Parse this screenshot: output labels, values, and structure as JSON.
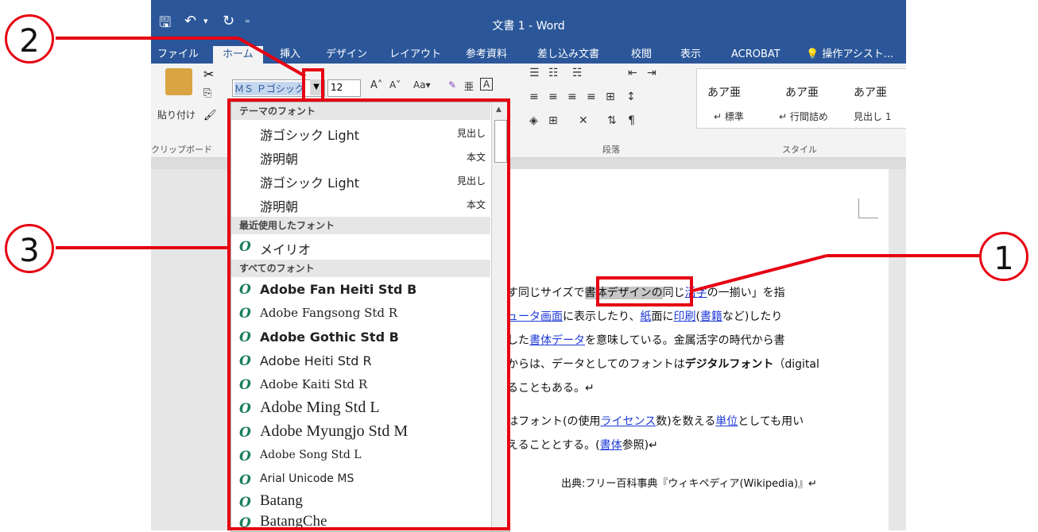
{
  "window": {
    "title": "文書 1 - Word",
    "quick_access": [
      "save-icon",
      "undo-icon",
      "redo-icon",
      "customize-icon"
    ]
  },
  "tabs": [
    {
      "label": "ファイル"
    },
    {
      "label": "ホーム",
      "active": true
    },
    {
      "label": "挿入"
    },
    {
      "label": "デザイン"
    },
    {
      "label": "レイアウト"
    },
    {
      "label": "参考資料"
    },
    {
      "label": "差し込み文書"
    },
    {
      "label": "校閲"
    },
    {
      "label": "表示"
    },
    {
      "label": "ACROBAT"
    }
  ],
  "tell_me": "操作アシスト...",
  "ribbon": {
    "paste_label": "貼り付け",
    "clipboard_label": "クリップボード",
    "font_name": "ＭＳ Ｐゴシック",
    "font_size": "12",
    "paragraph_label": "段落",
    "styles_label": "スタイル",
    "styles": [
      {
        "sample": "あア亜",
        "name": "↵ 標準"
      },
      {
        "sample": "あア亜",
        "name": "↵ 行間詰め"
      },
      {
        "sample": "あア亜",
        "name": "見出し 1"
      }
    ]
  },
  "dropdown": {
    "theme_fonts_header": "テーマのフォント",
    "theme_fonts": [
      {
        "name": "游ゴシック Light",
        "tag": "見出し"
      },
      {
        "name": "游明朝",
        "tag": "本文"
      },
      {
        "name": "游ゴシック Light",
        "tag": "見出し"
      },
      {
        "name": "游明朝",
        "tag": "本文"
      }
    ],
    "recent_header": "最近使用したフォント",
    "recent_fonts": [
      {
        "name": "メイリオ"
      }
    ],
    "all_header": "すべてのフォント",
    "all_fonts": [
      {
        "name": "Adobe Fan Heiti Std B"
      },
      {
        "name": "Adobe Fangsong Std R"
      },
      {
        "name": "Adobe Gothic Std B"
      },
      {
        "name": "Adobe Heiti Std R"
      },
      {
        "name": "Adobe Kaiti Std R"
      },
      {
        "name": "Adobe Ming Std L"
      },
      {
        "name": "Adobe Myungjo Std M"
      },
      {
        "name": "Adobe Song Std L"
      },
      {
        "name": "Arial Unicode MS"
      },
      {
        "name": "Batang"
      },
      {
        "name": "BatangChe"
      }
    ]
  },
  "document": {
    "line1_a": "す同じサイズで",
    "line1_sel": "書体デザインの",
    "line1_b": "同じ",
    "line1_link": "活字",
    "line1_c": "の一揃い」を指",
    "line2_link1": "ュータ画面",
    "line2_a": "に表示したり、",
    "line2_link2": "紙",
    "line2_b": "面に",
    "line2_link3": "印刷",
    "line2_c": "(",
    "line2_link4": "書籍",
    "line2_d": "など)したり",
    "line3_a": "した",
    "line3_link": "書体データ",
    "line3_b": "を意味している。金属活字の時代から書",
    "line4_a": "からは、データとしてのフォントは",
    "line4_bold": "デジタルフォント",
    "line4_b": "（digital",
    "line5": "ることもある。↵",
    "line6_a": "はフォント(の使用",
    "line6_link1": "ライセンス",
    "line6_b": "数)を数える",
    "line6_link2": "単位",
    "line6_c": "としても用い",
    "line7_a": "えることとする。(",
    "line7_link": "書体",
    "line7_b": "参照)↵",
    "source": "出典:フリー百科事典『ウィキペディア(Wikipedia)』↵"
  },
  "annotations": [
    "1",
    "2",
    "3"
  ],
  "colors": {
    "accent": "#2b579a",
    "annotation": "#e60012",
    "link": "#1f3bd6"
  }
}
